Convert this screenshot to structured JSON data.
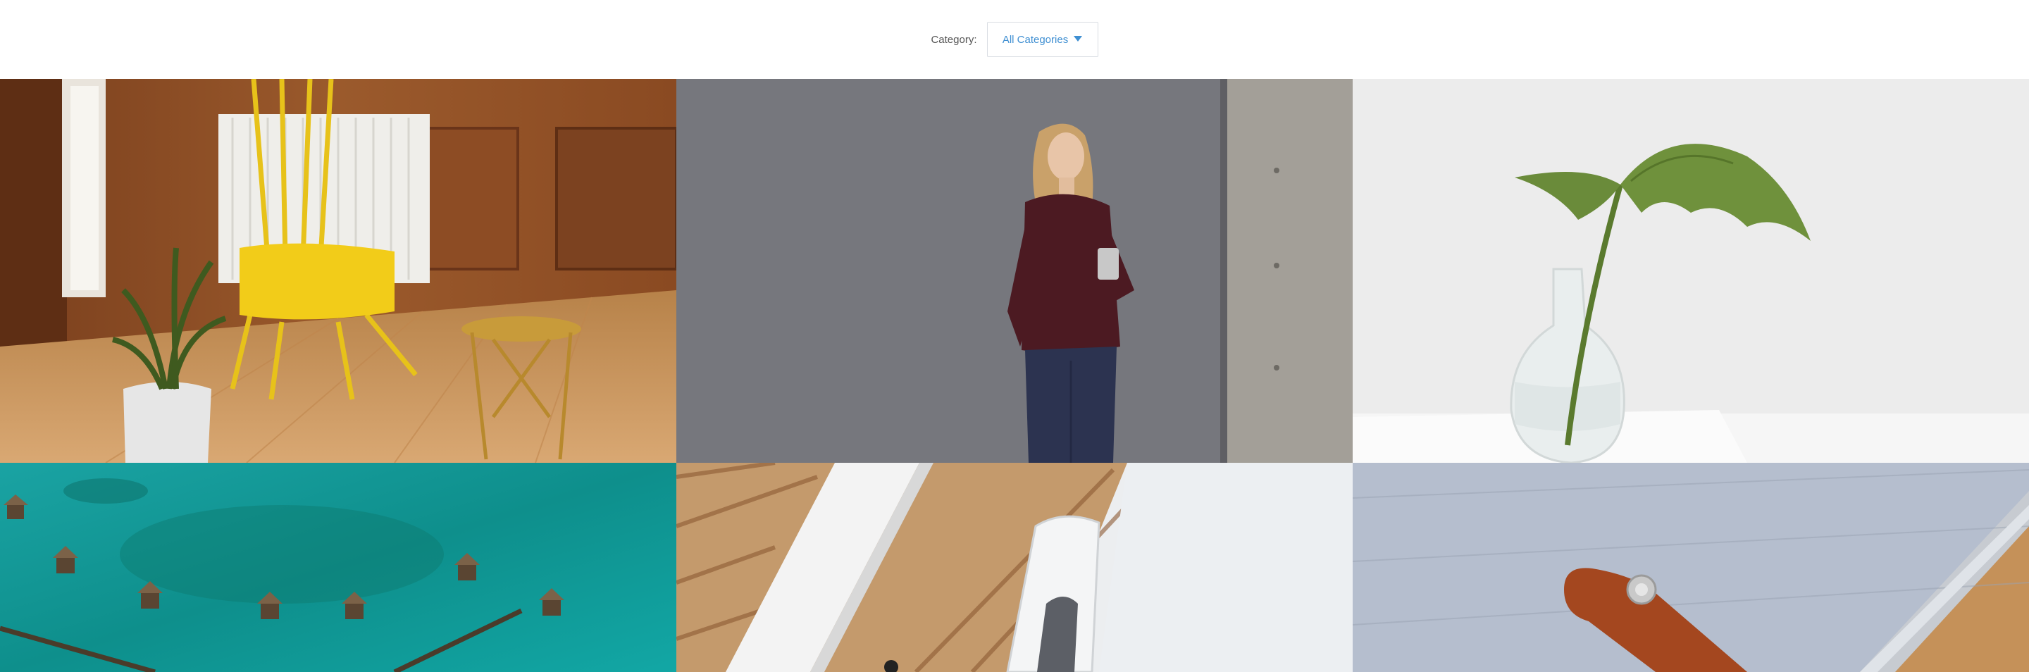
{
  "filter": {
    "label": "Category:",
    "selected": "All Categories",
    "caret_icon": "triangle-down-icon",
    "accent": "#3f8fd2"
  },
  "gallery": {
    "items": [
      {
        "subject": "yellow-chair-wood-room"
      },
      {
        "subject": "woman-phone-gray-wall"
      },
      {
        "subject": "monstera-leaf-vase"
      },
      {
        "subject": "overwater-bungalows-aerial"
      },
      {
        "subject": "white-bin-wood-floor"
      },
      {
        "subject": "felt-laptop-sleeve-leather-strap"
      }
    ]
  }
}
